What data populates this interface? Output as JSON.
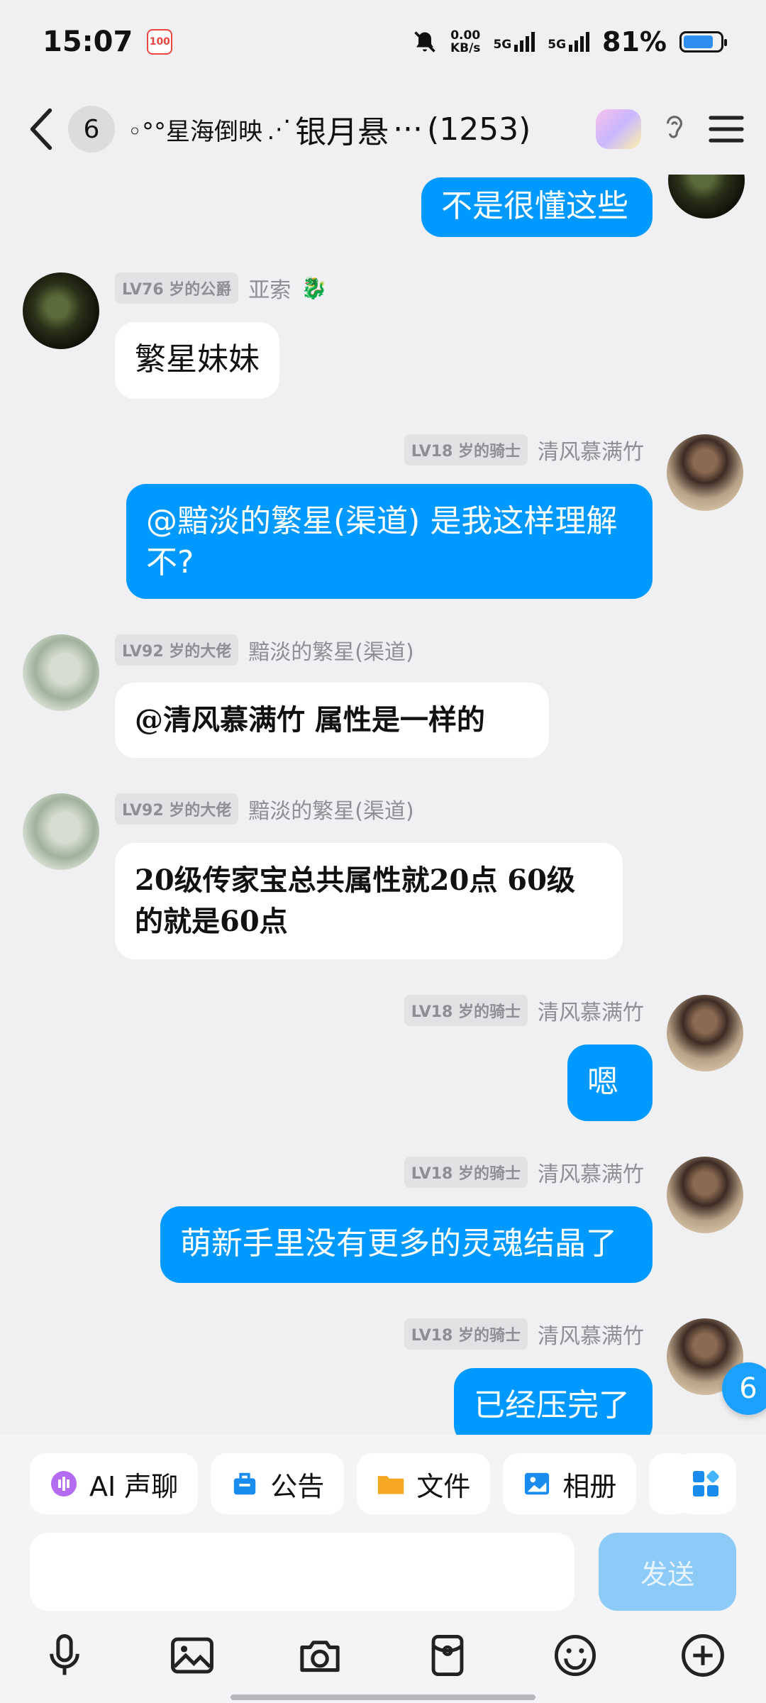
{
  "status": {
    "time": "15:07",
    "app_badge": "100",
    "speed_value": "0.00",
    "speed_unit": "KB/s",
    "net1": "5G",
    "net2": "5G",
    "battery": "81%"
  },
  "header": {
    "unread": "6",
    "title_prefix": "◦°°星海倒映",
    "title_mid": "银月悬",
    "title_ellipsis": "···",
    "member_count": "(1253)"
  },
  "messages": [
    {
      "side": "right",
      "text": "不是很懂这些"
    },
    {
      "side": "left",
      "level": "LV76 岁的公爵",
      "name": "亚索",
      "text": "繁星妹妹"
    },
    {
      "side": "right",
      "level": "LV18 岁的骑士",
      "name": "清风慕满竹",
      "text": "@黯淡的繁星(渠道) 是我这样理解不?"
    },
    {
      "side": "left",
      "level": "LV92 岁的大佬",
      "name": "黯淡的繁星(渠道)",
      "text": "@清风慕满竹 属性是一样的"
    },
    {
      "side": "left",
      "level": "LV92 岁的大佬",
      "name": "黯淡的繁星(渠道)",
      "text": "20级传家宝总共属性就20点 60级的就是60点"
    },
    {
      "side": "right",
      "level": "LV18 岁的骑士",
      "name": "清风慕满竹",
      "text": "嗯"
    },
    {
      "side": "right",
      "level": "LV18 岁的骑士",
      "name": "清风慕满竹",
      "text": "萌新手里没有更多的灵魂结晶了"
    },
    {
      "side": "right",
      "level": "LV18 岁的骑士",
      "name": "清风慕满竹",
      "text": "已经压完了"
    }
  ],
  "floating_unread": "6",
  "quickbar": [
    {
      "label": "AI 声聊",
      "icon": "ai-voice-icon",
      "color": "#b36bf2"
    },
    {
      "label": "公告",
      "icon": "announcement-icon",
      "color": "#1a8cf0"
    },
    {
      "label": "文件",
      "icon": "folder-icon",
      "color": "#f5a623"
    },
    {
      "label": "相册",
      "icon": "album-icon",
      "color": "#1a8cf0"
    }
  ],
  "input": {
    "placeholder": "",
    "send_label": "发送"
  },
  "toolbar": [
    "microphone-icon",
    "image-icon",
    "camera-icon",
    "red-packet-icon",
    "emoji-icon",
    "plus-icon"
  ]
}
